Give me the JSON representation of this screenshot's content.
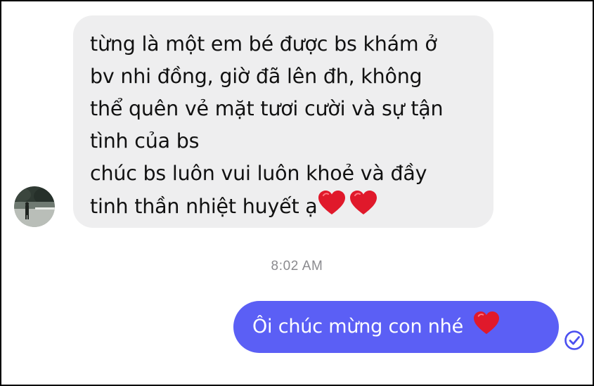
{
  "conversation": {
    "incoming": {
      "lines": [
        "từng là một em bé được bs khám ở",
        "bv nhi đồng, giờ đã lên đh, không",
        "thể quên vẻ mặt tươi cười và sự tận",
        "tình của bs",
        "chúc bs luôn vui luôn khoẻ và đầy",
        "tinh thần nhiệt huyết ạ"
      ],
      "trailing_icons": [
        "red-heart-icon",
        "red-heart-icon"
      ]
    },
    "timestamp": "8:02 AM",
    "outgoing": {
      "text": "Ôi chúc mừng con nhé",
      "trailing_icon": "red-heart-icon",
      "status_icon": "read-check-icon"
    }
  },
  "colors": {
    "incoming_bubble": "#eeeeef",
    "outgoing_bubble": "#5b5ff5",
    "timestamp_text": "#8a8a8e",
    "heart": "#e0192b",
    "read_check": "#4a4ff0"
  }
}
